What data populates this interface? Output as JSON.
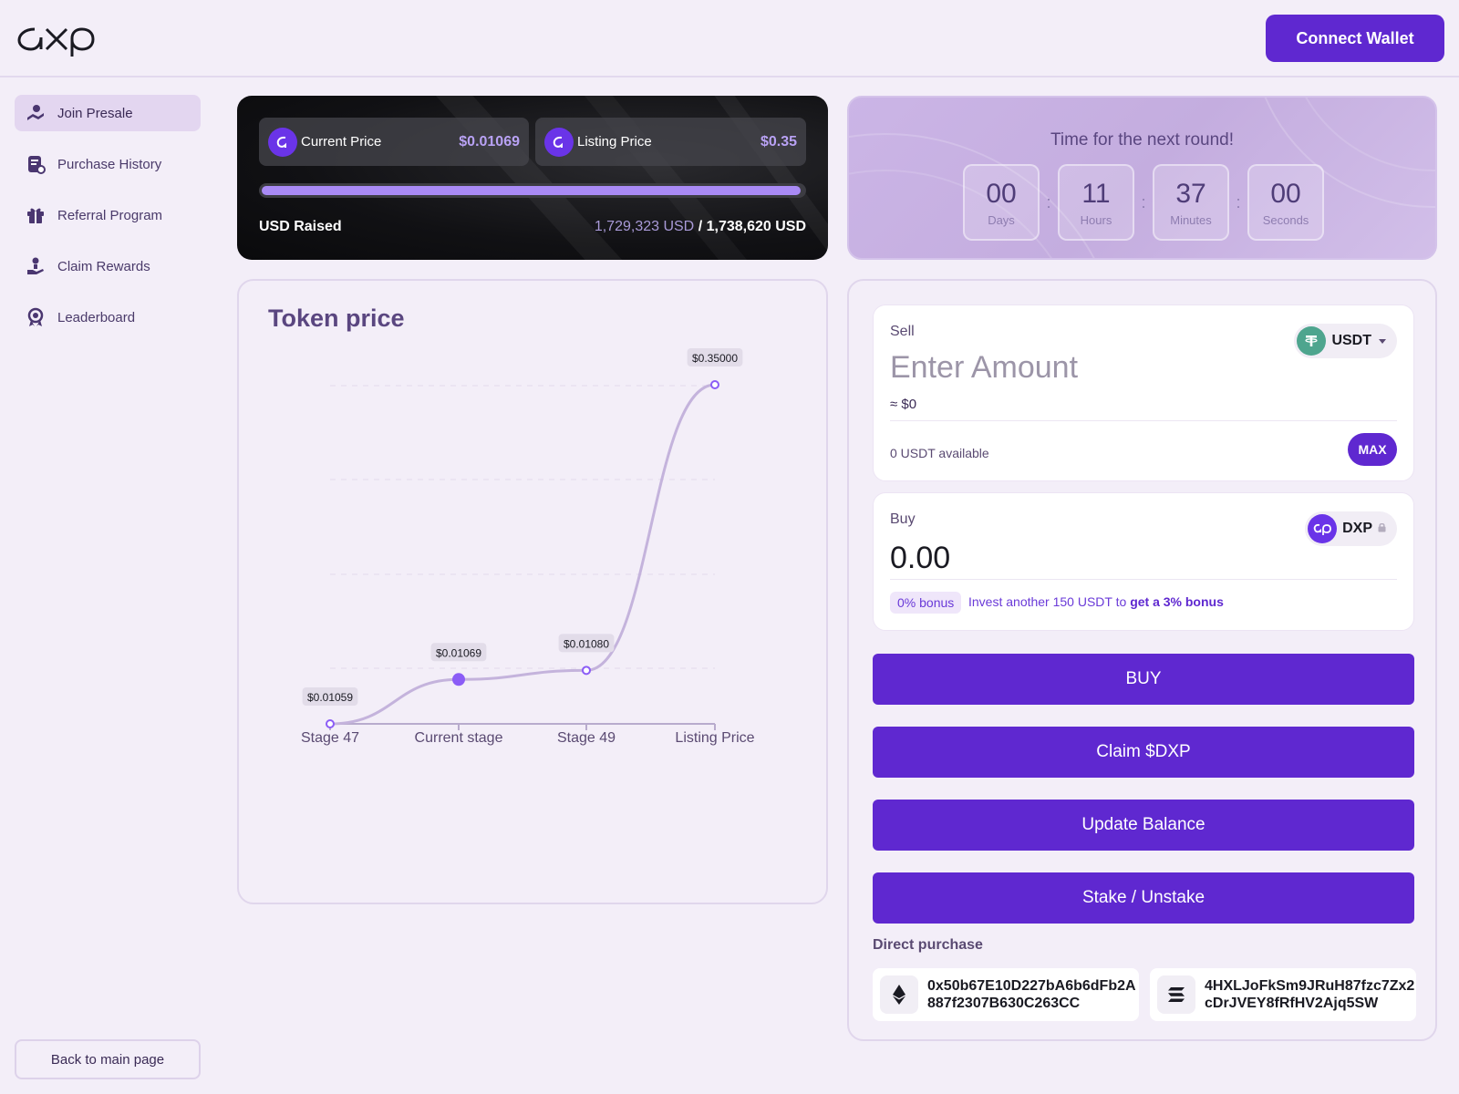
{
  "header": {
    "logo_text": "dxp",
    "connect_label": "Connect Wallet"
  },
  "sidebar": {
    "items": [
      {
        "label": "Join Presale",
        "icon": "presale-icon",
        "active": true
      },
      {
        "label": "Purchase History",
        "icon": "history-icon",
        "active": false
      },
      {
        "label": "Referral Program",
        "icon": "gift-icon",
        "active": false
      },
      {
        "label": "Claim Rewards",
        "icon": "claim-icon",
        "active": false
      },
      {
        "label": "Leaderboard",
        "icon": "award-icon",
        "active": false
      }
    ],
    "back_label": "Back to main page"
  },
  "price_panel": {
    "current_label": "Current Price",
    "current_value": "$0.01069",
    "listing_label": "Listing Price",
    "listing_value": "$0.35",
    "progress_fraction": 0.9947,
    "raised_label": "USD Raised",
    "raised_current": "1,729,323 USD",
    "raised_separator": "/",
    "raised_total": "1,738,620 USD"
  },
  "countdown": {
    "title": "Time for the next round!",
    "units": [
      {
        "value": "00",
        "label": "Days"
      },
      {
        "value": "11",
        "label": "Hours"
      },
      {
        "value": "37",
        "label": "Minutes"
      },
      {
        "value": "00",
        "label": "Seconds"
      }
    ],
    "separator": ":"
  },
  "chart": {
    "title": "Token price"
  },
  "chart_data": {
    "type": "line",
    "categories": [
      "Stage 47",
      "Current stage",
      "Stage 49",
      "Listing Price"
    ],
    "series": [
      {
        "values": [
          0.01059,
          0.01069,
          0.0108,
          0.35
        ]
      }
    ],
    "data_labels": [
      "$0.01059",
      "$0.01069",
      "$0.01080",
      "$0.35000"
    ],
    "highlight_index": 1,
    "grid": true,
    "colors": {
      "line": "#c4b3dc",
      "point": "#8b5cf6"
    }
  },
  "swap": {
    "sell_label": "Sell",
    "sell_placeholder": "Enter Amount",
    "sell_token": "USDT",
    "usd_approx": "≈ $0",
    "available": "0 USDT available",
    "max_label": "MAX",
    "buy_label": "Buy",
    "buy_amount": "0.00",
    "buy_token": "DXP",
    "bonus_pill": "0% bonus",
    "bonus_text": "Invest another 150 USDT to",
    "bonus_strong": "get a 3% bonus",
    "buttons": {
      "buy": "BUY",
      "claim": "Claim $DXP",
      "update": "Update Balance",
      "stake": "Stake / Unstake"
    },
    "direct_title": "Direct purchase",
    "eth_address": "0x50b67E10D227bA6b6dFb2A887f2307B630C263CC",
    "sol_address": "4HXLJoFkSm9JRuH87fzc7Zx2cDrJVEY8fRfHV2Ajq5SW"
  },
  "colors": {
    "accent": "#5f28d0",
    "background": "#f3eef8",
    "usdt": "#4ea58e",
    "dxp": "#6a34e8"
  }
}
